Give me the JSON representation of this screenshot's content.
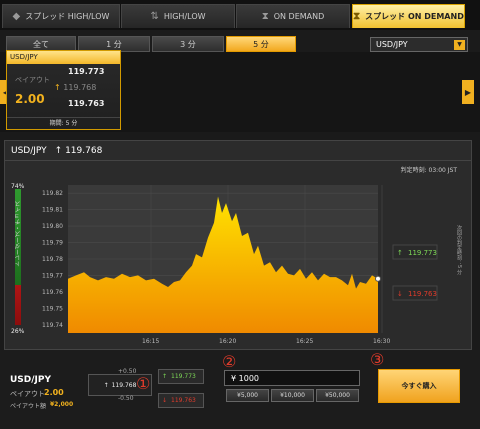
{
  "top_tabs": [
    {
      "label": "スプレッド HIGH/LOW",
      "icon": "diamond-icon"
    },
    {
      "label": "HIGH/LOW",
      "icon": "updown-icon"
    },
    {
      "label": "ON DEMAND",
      "icon": "hourglass-icon"
    },
    {
      "label": "スプレッド ON DEMAND",
      "icon": "hourglass-icon",
      "active": true
    }
  ],
  "time_tabs": [
    "全て",
    "1 分",
    "3 分",
    "5 分"
  ],
  "time_tabs_active_index": 3,
  "pair_select": {
    "value": "USD/JPY"
  },
  "card": {
    "pair": "USD/JPY",
    "payout_label": "ペイアウト",
    "payout_value": "2.00",
    "high": "119.773",
    "current": "119.768",
    "low": "119.763",
    "period": "期間: 5 分"
  },
  "panel": {
    "pair": "USD/JPY",
    "rate": "119.768",
    "judge_time_label": "判定時刻:",
    "judge_time_value": "03:00 JST",
    "trader_choice_label": "トレーダーズ・チョイス",
    "right_label": "次回の判定時刻：5 分",
    "top_pct": "74%",
    "bottom_pct": "26%",
    "high_marker": "119.773",
    "low_marker": "119.763"
  },
  "chart_data": {
    "type": "area",
    "x_ticks": [
      "16:15",
      "16:20",
      "16:25",
      "16:30"
    ],
    "y_ticks": [
      "119.82",
      "119.81",
      "119.80",
      "119.79",
      "119.78",
      "119.77",
      "119.76",
      "119.75",
      "119.74"
    ],
    "ylim": [
      119.735,
      119.825
    ],
    "last_value": 119.768,
    "fill_colors": [
      "#f8d000",
      "#f28c00"
    ]
  },
  "bottom": {
    "pair": "USD/JPY",
    "payout_label": "ペイアウト",
    "payout_value": "2.00",
    "pay_amount_label": "ペイアウト額",
    "pay_amount_value": "¥2,000",
    "rate": "119.768",
    "plus": "+0.50",
    "minus": "-0.50",
    "high_button": "119.773",
    "low_button": "119.763",
    "amount": "¥ 1000",
    "quick_amounts": [
      "¥5,000",
      "¥10,000",
      "¥50,000"
    ],
    "buy_label": "今すぐ購入",
    "markers": [
      "①",
      "②",
      "③"
    ]
  }
}
